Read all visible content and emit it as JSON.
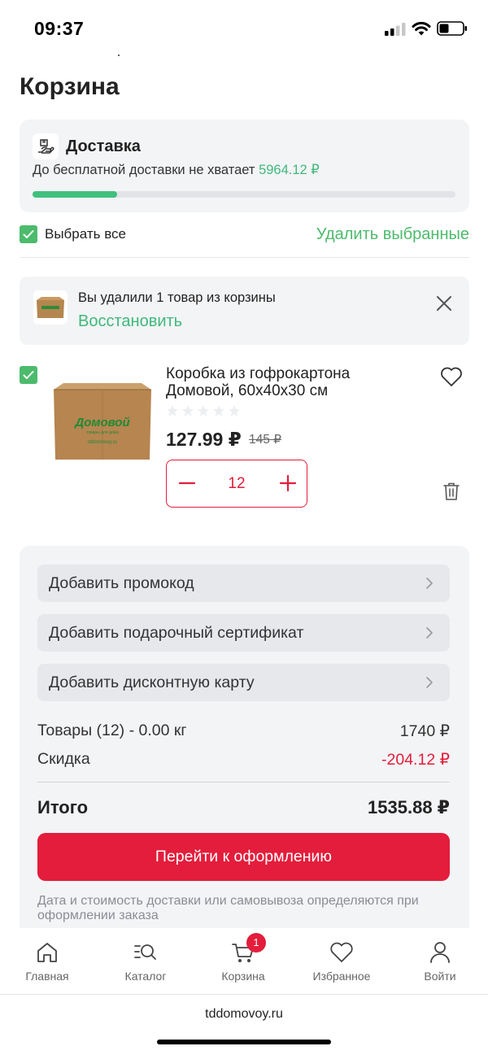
{
  "status_bar": {
    "time": "09:37"
  },
  "page": {
    "title": "Корзина"
  },
  "delivery": {
    "title": "Доставка",
    "text": "До бесплатной доставки не хватает",
    "amount": "5964.12 ₽",
    "progress": 0.2,
    "icon": "delivery-box-icon"
  },
  "selection": {
    "select_all_label": "Выбрать все",
    "select_all_checked": true,
    "delete_selected_label": "Удалить выбранные"
  },
  "removed_notice": {
    "text": "Вы удалили 1 товар из корзины",
    "restore_label": "Восстановить",
    "close_icon": "close-icon"
  },
  "product": {
    "checked": true,
    "name": "Коробка из гофрокартона Домовой, 60х40х30 см",
    "rating": 0,
    "price": "127.99 ₽",
    "old_price": "145 ₽",
    "quantity": "12",
    "image_brand": "Домовой",
    "image_tagline": "товары для дома",
    "image_site": "tddomovoy.ru"
  },
  "summary": {
    "options": [
      {
        "label": "Добавить промокод"
      },
      {
        "label": "Добавить подарочный сертификат"
      },
      {
        "label": "Добавить дисконтную карту"
      }
    ],
    "goods_label": "Товары (12) - 0.00 кг",
    "goods_value": "1740 ₽",
    "discount_label": "Скидка",
    "discount_value": "-204.12 ₽",
    "total_label": "Итого",
    "total_value": "1535.88 ₽",
    "checkout_label": "Перейти к оформлению",
    "note": "Дата и стоимость доставки или самовывоза определяются при оформлении заказа"
  },
  "tab_bar": {
    "items": [
      {
        "label": "Главная",
        "icon": "home-icon"
      },
      {
        "label": "Каталог",
        "icon": "catalog-search-icon"
      },
      {
        "label": "Корзина",
        "icon": "cart-icon",
        "badge": "1"
      },
      {
        "label": "Избранное",
        "icon": "heart-icon"
      },
      {
        "label": "Войти",
        "icon": "user-icon"
      }
    ]
  },
  "browser": {
    "url": "tddomovoy.ru"
  },
  "colors": {
    "accent_green": "#3fb97a",
    "accent_red": "#e31d3b",
    "card_bg": "#f3f4f6"
  }
}
